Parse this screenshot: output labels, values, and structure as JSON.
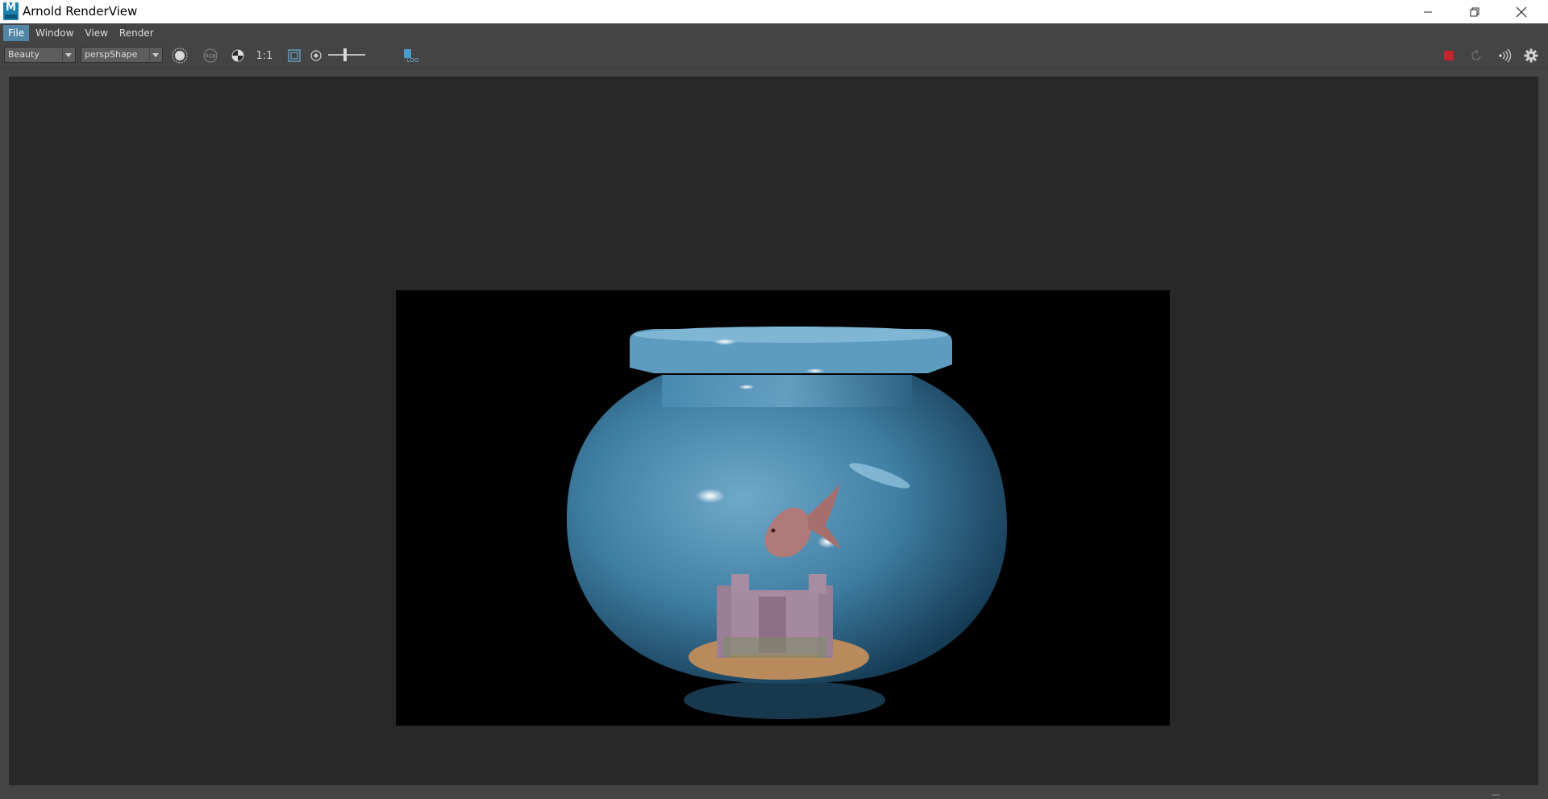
{
  "window": {
    "title": "Arnold RenderView",
    "logo_letter": "M"
  },
  "menu": {
    "items": [
      "File",
      "Window",
      "View",
      "Render"
    ]
  },
  "toolbar": {
    "aov_value": "Beauty",
    "camera_value": "perspShape",
    "ratio_label": "1:1",
    "rgb_label": "RGB",
    "exposure_value": "0",
    "log_label": "LOG"
  },
  "colors": {
    "accent": "#5285a6",
    "stop_red": "#c0262c",
    "background": "#444444",
    "viewport": "#282828"
  },
  "icons": {
    "toolbar": [
      "channel-circle-icon",
      "rgb-icon",
      "checker-icon",
      "crop-region-icon",
      "exposure-icon",
      "log-icon"
    ],
    "right": [
      "stop-render-icon",
      "refresh-render-icon",
      "ipr-icon",
      "settings-gear-icon"
    ]
  }
}
